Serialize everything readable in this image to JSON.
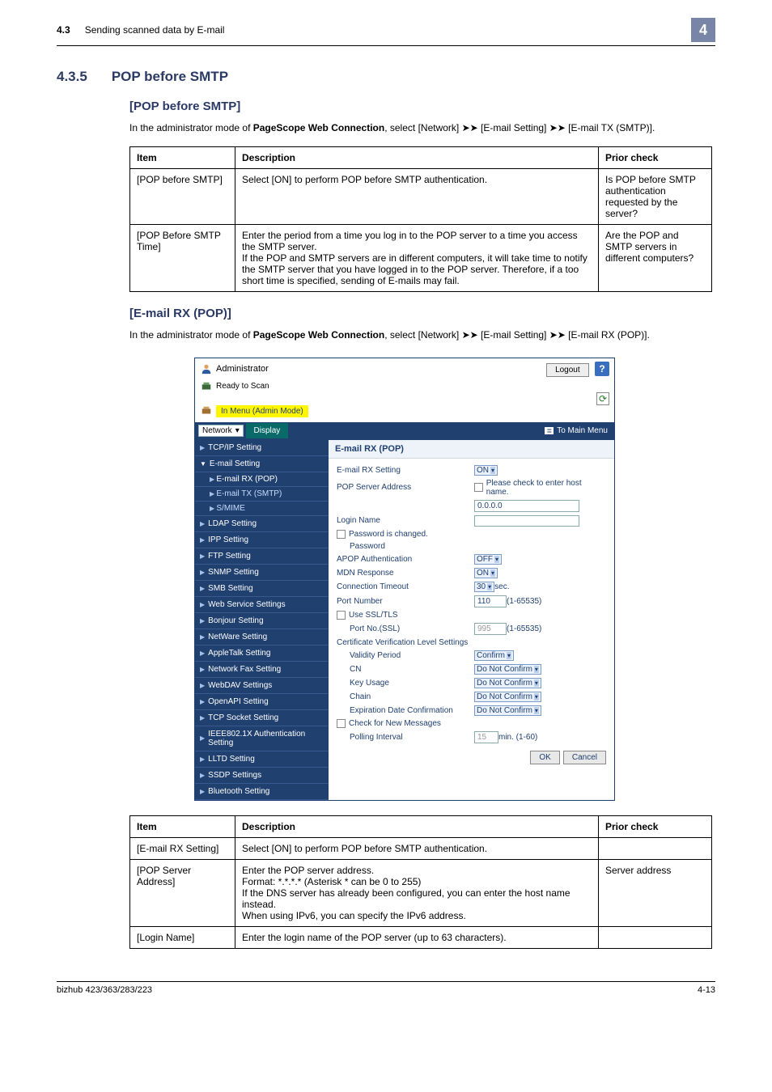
{
  "header": {
    "section_num": "4.3",
    "section_title": "Sending scanned data by E-mail",
    "chapter": "4"
  },
  "h2": {
    "num": "4.3.5",
    "title": "POP before SMTP"
  },
  "h3a": "[POP before SMTP]",
  "intro_a_1": "In the administrator mode of ",
  "intro_a_bold": "PageScope Web Connection",
  "intro_a_2": ", select [Network] ➤➤ [E-mail Setting] ➤➤ [E-mail TX (SMTP)].",
  "table1": {
    "h_item": "Item",
    "h_desc": "Description",
    "h_prior": "Prior check",
    "r1_item": "[POP before SMTP]",
    "r1_desc": "Select [ON] to perform POP before SMTP authentication.",
    "r1_prior": "Is POP before SMTP authentication requested by the server?",
    "r2_item": "[POP Before SMTP Time]",
    "r2_desc": "Enter the period from a time you log in to the POP server to a time you access the SMTP server.\nIf the POP and SMTP servers are in different computers, it will take time to notify the SMTP server that you have logged in to the POP server. Therefore, if a too short time is specified, sending of E-mails may fail.",
    "r2_prior": "Are the POP and SMTP servers in different computers?"
  },
  "h3b": "[E-mail RX (POP)]",
  "intro_b_1": "In the administrator mode of ",
  "intro_b_bold": "PageScope Web Connection",
  "intro_b_2": ", select [Network] ➤➤ [E-mail Setting] ➤➤ [E-mail RX (POP)].",
  "ss": {
    "admin": "Administrator",
    "logout": "Logout",
    "help": "?",
    "ready": "Ready to Scan",
    "inmenu": "In Menu (Admin Mode)",
    "nav_sel": "Network",
    "display": "Display",
    "tomain": "To Main Menu",
    "side": {
      "tcpip": "TCP/IP Setting",
      "email": "E-mail Setting",
      "rxpop": "E-mail RX (POP)",
      "txsmtp": "E-mail TX (SMTP)",
      "smime": "S/MIME",
      "ldap": "LDAP Setting",
      "ipp": "IPP Setting",
      "ftp": "FTP Setting",
      "snmp": "SNMP Setting",
      "smb": "SMB Setting",
      "webservice": "Web Service Settings",
      "bonjour": "Bonjour Setting",
      "netware": "NetWare Setting",
      "appletalk": "AppleTalk Setting",
      "netfax": "Network Fax Setting",
      "webdav": "WebDAV Settings",
      "openapi": "OpenAPI Setting",
      "tcpsock": "TCP Socket Setting",
      "ieee": "IEEE802.1X Authentication Setting",
      "lltd": "LLTD Setting",
      "ssdp": "SSDP Settings",
      "bluetooth": "Bluetooth Setting"
    },
    "main": {
      "title": "E-mail RX (POP)",
      "rxsetting": "E-mail RX Setting",
      "rxval": "ON",
      "popaddr": "POP Server Address",
      "popnote": "Please check to enter host name.",
      "popval": "0.0.0.0",
      "login": "Login Name",
      "pwchanged": "Password is changed.",
      "password": "Password",
      "apop": "APOP Authentication",
      "apopval": "OFF",
      "mdn": "MDN Response",
      "mdnval": "ON",
      "timeout": "Connection Timeout",
      "timeoutval": "30",
      "timeoutunit": "sec.",
      "portnum": "Port Number",
      "portval": "110",
      "portrange": "(1-65535)",
      "usessl": "Use SSL/TLS",
      "portssl": "Port No.(SSL)",
      "portsslval": "995",
      "portsslrange": "(1-65535)",
      "cert": "Certificate Verification Level Settings",
      "validity": "Validity Period",
      "validityval": "Confirm",
      "cn": "CN",
      "cnval": "Do Not Confirm",
      "keyusage": "Key Usage",
      "keyusageval": "Do Not Confirm",
      "chain": "Chain",
      "chainval": "Do Not Confirm",
      "expdate": "Expiration Date Confirmation",
      "expdateval": "Do Not Confirm",
      "checknew": "Check for New Messages",
      "polling": "Polling Interval",
      "pollingval": "15",
      "pollingunit": "min.  (1-60)",
      "ok": "OK",
      "cancel": "Cancel"
    }
  },
  "table2": {
    "h_item": "Item",
    "h_desc": "Description",
    "h_prior": "Prior check",
    "r1_item": "[E-mail RX Setting]",
    "r1_desc": "Select [ON] to perform POP before SMTP authentication.",
    "r1_prior": "",
    "r2_item": "[POP Server Address]",
    "r2_desc": "Enter the POP server address.\nFormat: *.*.*.* (Asterisk * can be 0 to 255)\nIf the DNS server has already been configured, you can enter the host name instead.\nWhen using IPv6, you can specify the IPv6 address.",
    "r2_prior": "Server address",
    "r3_item": "[Login Name]",
    "r3_desc": "Enter the login name of the POP server (up to 63 characters).",
    "r3_prior": ""
  },
  "footer": {
    "model": "bizhub 423/363/283/223",
    "page": "4-13"
  }
}
